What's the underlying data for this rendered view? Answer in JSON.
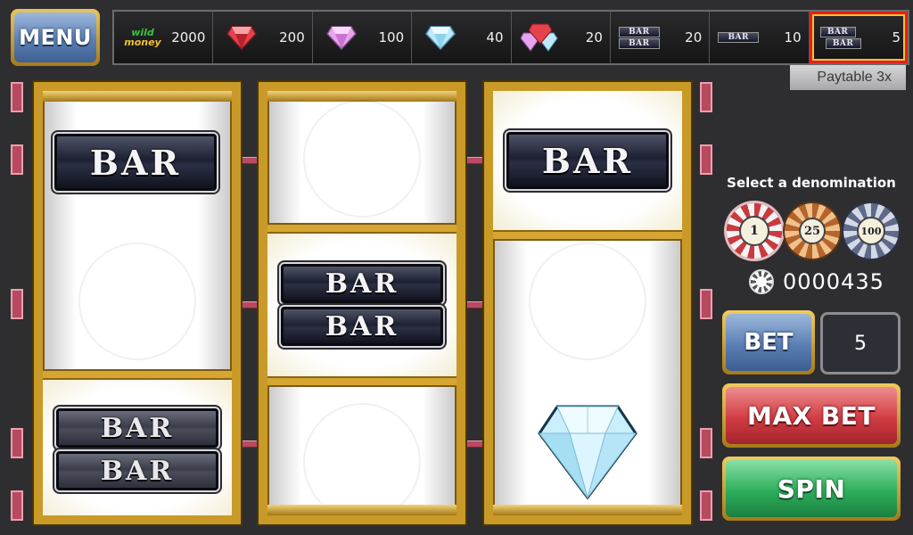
{
  "menu": {
    "label": "MENU"
  },
  "paytable": {
    "tag": "Paytable 3x",
    "entries": [
      {
        "symbol": "wild-money-icon",
        "payout": "2000",
        "logo_top": "wild",
        "logo_bottom": "money"
      },
      {
        "symbol": "red-gem-icon",
        "payout": "200"
      },
      {
        "symbol": "pink-gem-icon",
        "payout": "100"
      },
      {
        "symbol": "blue-diamond-icon",
        "payout": "40"
      },
      {
        "symbol": "any-gem-icon",
        "payout": "20"
      },
      {
        "symbol": "double-bar-icon",
        "payout": "20",
        "bar_text": "BAR"
      },
      {
        "symbol": "single-bar-icon",
        "payout": "10",
        "bar_text": "BAR"
      },
      {
        "symbol": "any-bar-icon",
        "payout": "5",
        "bar_text": "BAR"
      }
    ],
    "highlighted_index": 7
  },
  "reels": {
    "reel1": {
      "top": "BAR",
      "bottom_line1": "BAR",
      "bottom_line2": "BAR"
    },
    "reel2": {
      "middle_line1": "BAR",
      "middle_line2": "BAR"
    },
    "reel3": {
      "top": "BAR",
      "bottom": "blue-diamond-icon"
    }
  },
  "denomination": {
    "title": "Select a denomination",
    "chips": [
      "1",
      "25",
      "100"
    ]
  },
  "credits": {
    "value": "0000435"
  },
  "bet": {
    "label": "BET",
    "value": "5"
  },
  "buttons": {
    "max_bet": "MAX BET",
    "spin": "SPIN"
  },
  "colors": {
    "gold": "#c99a27",
    "highlight_red": "#e5201d",
    "max_bet": "#d23c43",
    "spin": "#2cae5b",
    "bet_blue": "#5b7fb3"
  }
}
